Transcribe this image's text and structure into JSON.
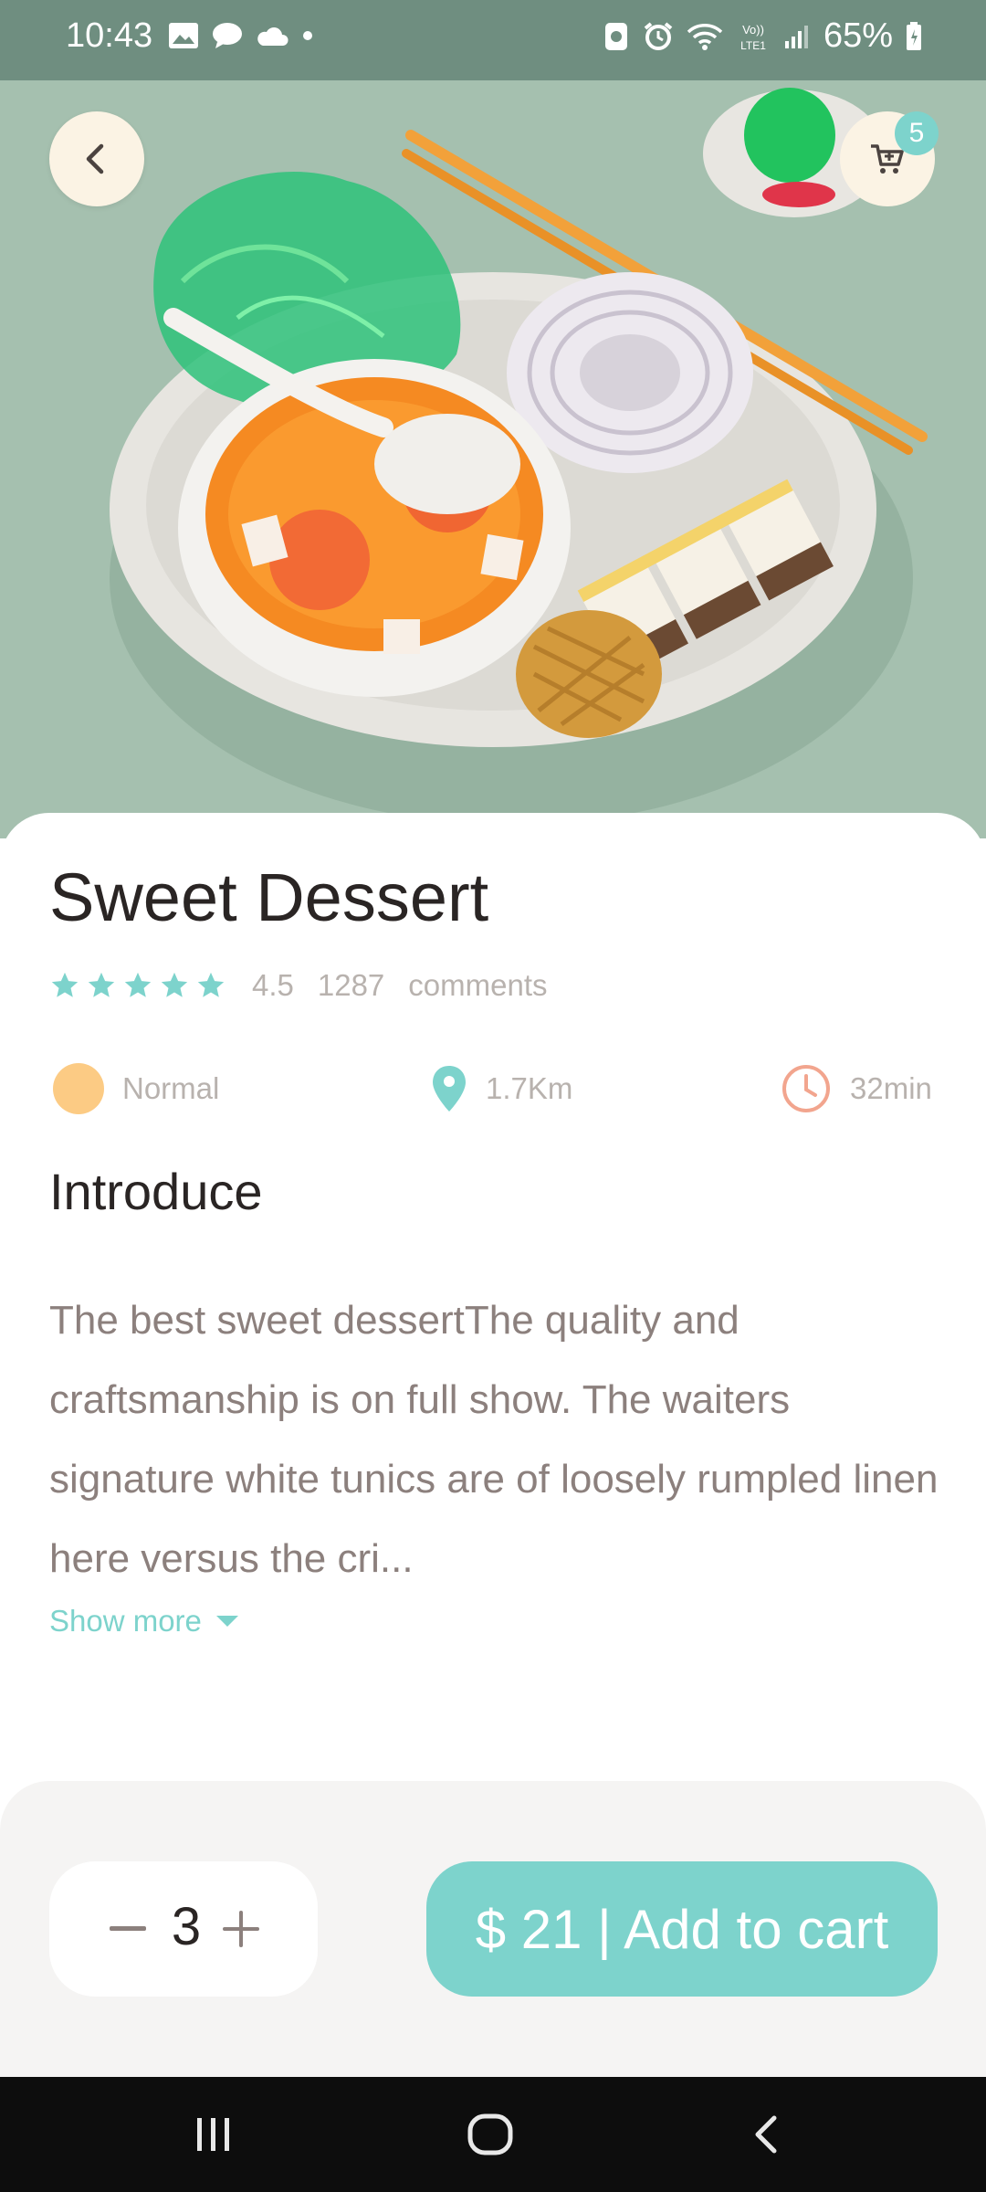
{
  "status": {
    "time": "10:43",
    "battery": "65%",
    "left_icons": [
      "image-icon",
      "chat-icon",
      "cloud-icon",
      "dot-icon"
    ],
    "right_icons": [
      "nfc-icon",
      "alarm-icon",
      "wifi-icon",
      "volte-icon",
      "signal-icon",
      "battery-icon"
    ]
  },
  "header": {
    "back_icon": "chevron-left-icon",
    "cart_icon": "cart-icon",
    "cart_count": "5"
  },
  "product": {
    "title": "Sweet Dessert",
    "stars": 5,
    "rating": "4.5",
    "comments_count": "1287",
    "comments_label": "comments",
    "spice_level": "Normal",
    "distance": "1.7Km",
    "time": "32min"
  },
  "intro": {
    "title": "Introduce",
    "text": "The best sweet dessertThe quality and craftsmanship is on full show. The waiters signature white tunics are of loosely rumpled linen here versus the cri...",
    "show_more": "Show more"
  },
  "cart": {
    "quantity": "3",
    "add_label": "$ 21 | Add to cart"
  },
  "colors": {
    "accent": "#7dd3cc",
    "warm": "#fccb84",
    "clock": "#f2a58e",
    "text": "#2a2524",
    "muted": "#b8b2ae"
  }
}
